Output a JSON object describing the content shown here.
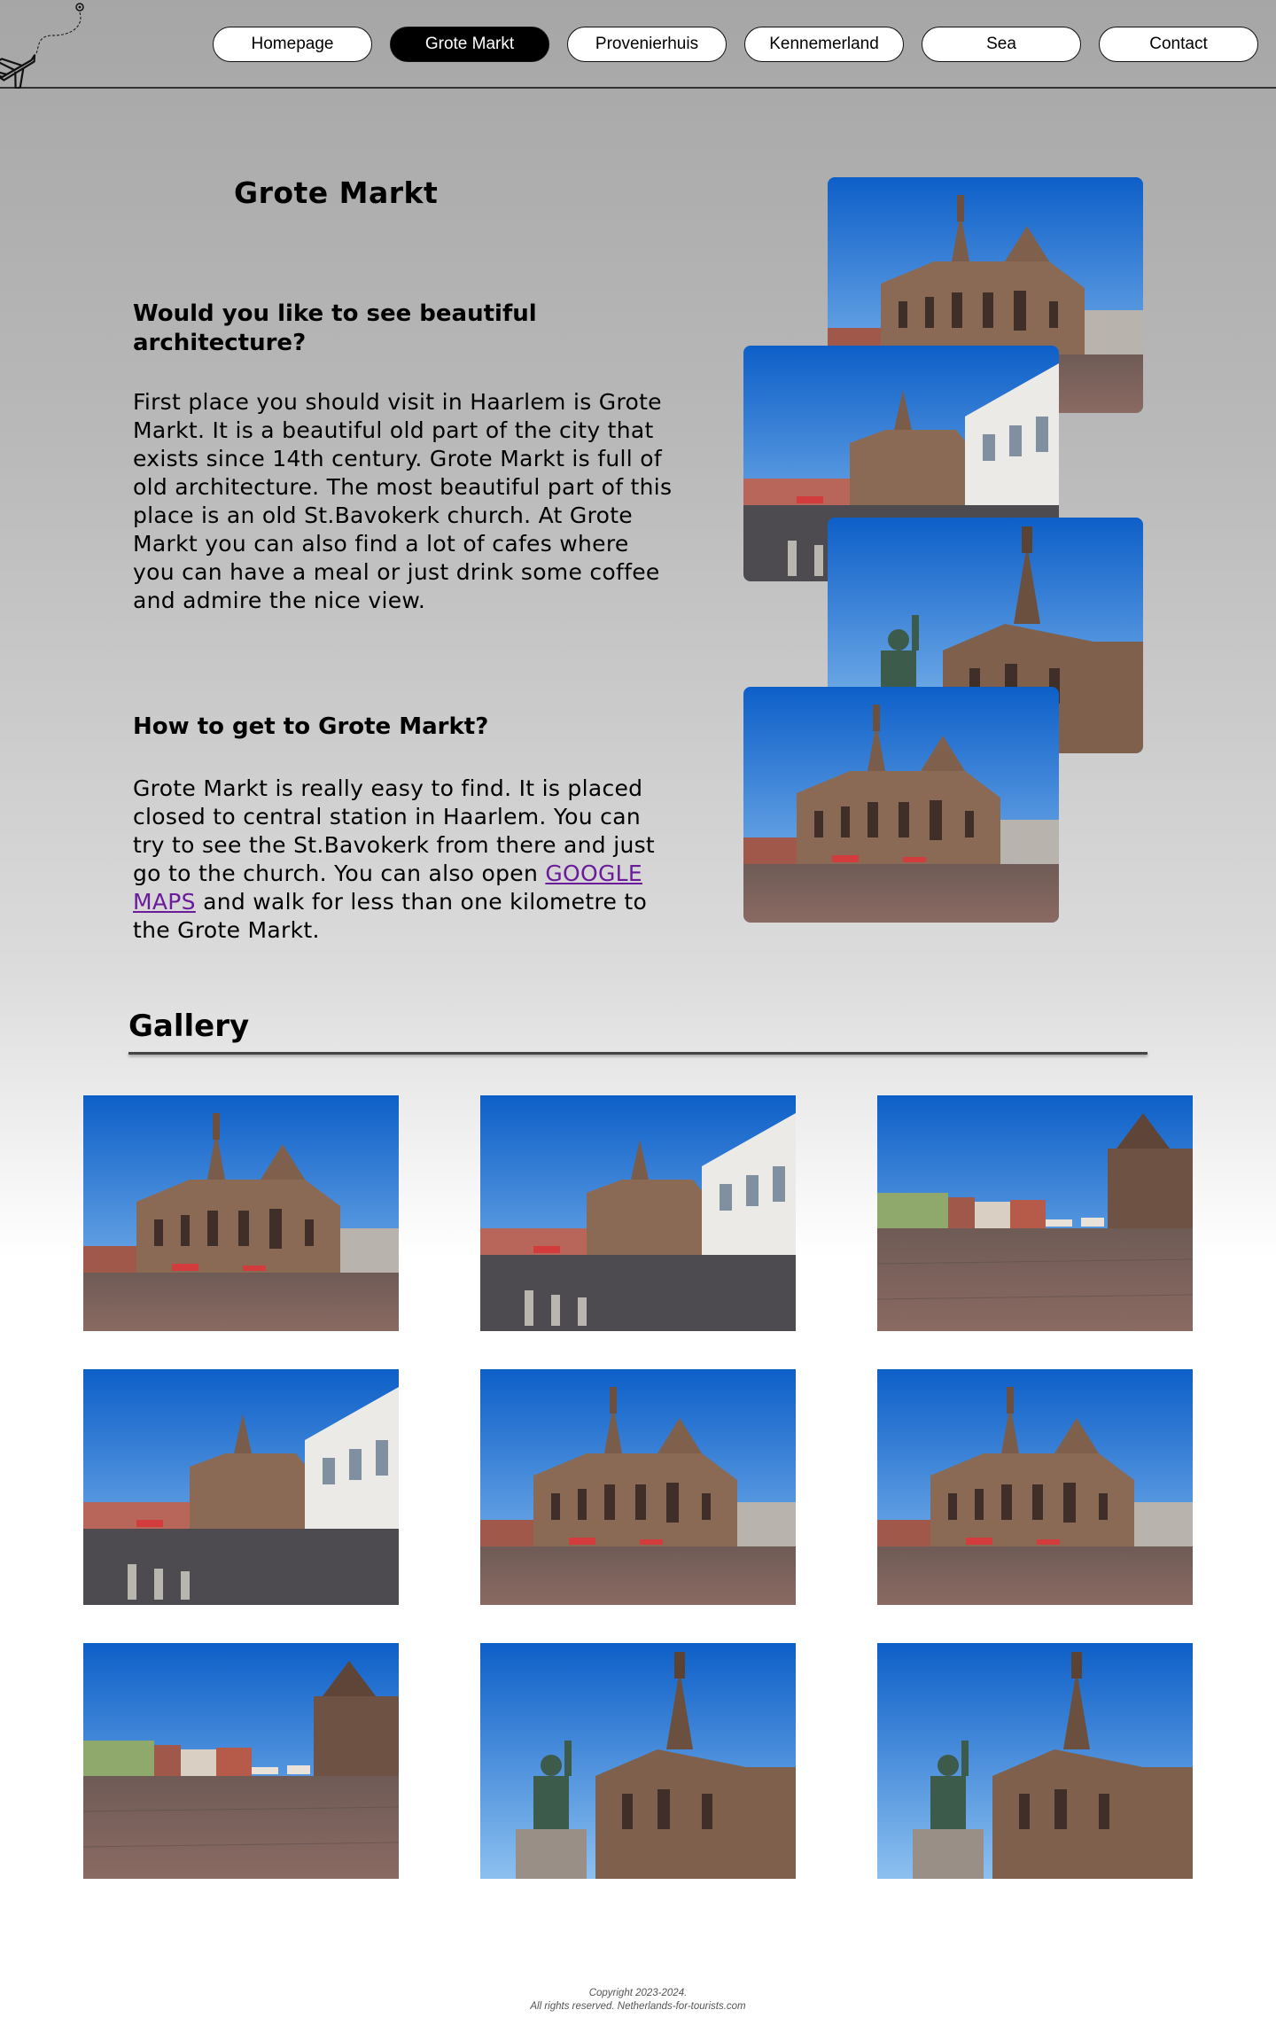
{
  "nav": {
    "items": [
      {
        "label": "Homepage",
        "active": false
      },
      {
        "label": "Grote Markt",
        "active": true
      },
      {
        "label": "Provenierhuis",
        "active": false
      },
      {
        "label": "Kennemerland",
        "active": false
      },
      {
        "label": "Sea",
        "active": false
      },
      {
        "label": "Contact",
        "active": false
      }
    ]
  },
  "logo": {
    "icon": "airplane-route-icon"
  },
  "main": {
    "title": "Grote Markt",
    "section1": {
      "heading": "Would you like to see beautiful architecture?",
      "body": "First place you should visit in Haarlem is Grote Markt. It is a beautiful old part of the city that exists since 14th century. Grote Markt is full of old architecture. The most beautiful part of this place is an old St.Bavokerk church. At Grote Markt you can also find a lot of cafes where you can have a meal or just drink some coffee and admire the nice view."
    },
    "section2": {
      "heading": "How to get to Grote Markt?",
      "body_before": "Grote Markt is really easy to find. It is placed closed to central station in Haarlem. You can try to see the St.Bavokerk from there and just go to the church. You can also open",
      "link_label": "GOOGLE MAPS",
      "body_after": "and walk for less than one kilometre to the Grote Markt."
    }
  },
  "gallery": {
    "title": "Gallery"
  },
  "footer": {
    "line1": "Copyright 2023-2024.",
    "line2": "All rights reserved. Netherlands-for-tourists.com"
  },
  "colors": {
    "sky_top": "#1d6fd1",
    "sky_bottom": "#7fb6ee",
    "stone": "#8a6a55",
    "pavement": "#6e5a55",
    "link": "#6a1b9a",
    "active_nav_bg": "#000000"
  }
}
